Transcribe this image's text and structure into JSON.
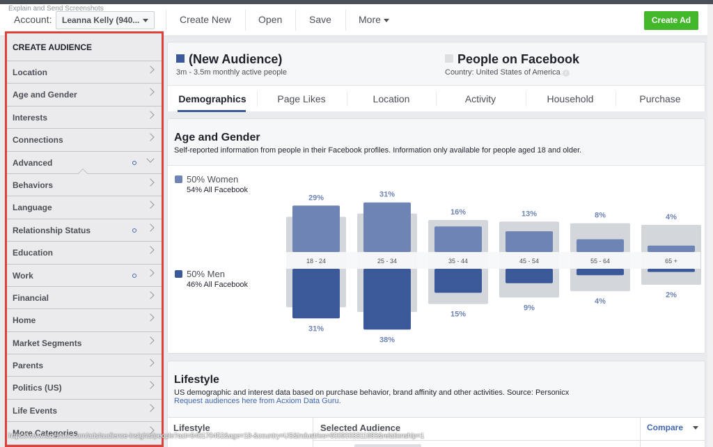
{
  "overlay_caption": "Explain and Send Screenshots",
  "header": {
    "account_label": "Account:",
    "account_value": "Leanna Kelly (940...",
    "nav": [
      "Create New",
      "Open",
      "Save",
      "More"
    ],
    "create_ad": "Create Ad",
    "create_ad_color": "#42b72a"
  },
  "sidebar": {
    "title": "CREATE AUDIENCE",
    "items": [
      {
        "label": "Location",
        "dot": false,
        "expanded": false
      },
      {
        "label": "Age and Gender",
        "dot": false,
        "expanded": false
      },
      {
        "label": "Interests",
        "dot": false,
        "expanded": false
      },
      {
        "label": "Connections",
        "dot": false,
        "expanded": false
      },
      {
        "label": "Advanced",
        "dot": true,
        "expanded": true
      },
      {
        "label": "Behaviors",
        "dot": false,
        "expanded": false
      },
      {
        "label": "Language",
        "dot": false,
        "expanded": false
      },
      {
        "label": "Relationship Status",
        "dot": true,
        "expanded": false
      },
      {
        "label": "Education",
        "dot": false,
        "expanded": false
      },
      {
        "label": "Work",
        "dot": true,
        "expanded": false
      },
      {
        "label": "Financial",
        "dot": false,
        "expanded": false
      },
      {
        "label": "Home",
        "dot": false,
        "expanded": false
      },
      {
        "label": "Market Segments",
        "dot": false,
        "expanded": false
      },
      {
        "label": "Parents",
        "dot": false,
        "expanded": false
      },
      {
        "label": "Politics (US)",
        "dot": false,
        "expanded": false
      },
      {
        "label": "Life Events",
        "dot": false,
        "expanded": false
      },
      {
        "label": "More Categories",
        "dot": false,
        "expanded": false
      }
    ]
  },
  "audience": {
    "selected_title": "(New Audience)",
    "selected_sub": "3m - 3.5m monthly active people",
    "selected_color": "#3b5998",
    "compare_title": "People on Facebook",
    "compare_sub": "Country: United States of America",
    "compare_color": "#dddfe2",
    "info_icon": "i"
  },
  "tabs": [
    "Demographics",
    "Page Likes",
    "Location",
    "Activity",
    "Household",
    "Purchase"
  ],
  "active_tab": "Demographics",
  "age_gender": {
    "title": "Age and Gender",
    "subtitle": "Self-reported information from people in their Facebook profiles. Information only available for people aged 18 and older.",
    "women_label": "50% Women",
    "women_sub": "54% All Facebook",
    "men_label": "50% Men",
    "men_sub": "46% All Facebook"
  },
  "chart_data": {
    "type": "bar",
    "title": "Age and Gender",
    "categories": [
      "18 - 24",
      "25 - 34",
      "35 - 44",
      "45 - 54",
      "55 - 64",
      "65 +"
    ],
    "series": [
      {
        "name": "Women",
        "values": [
          29,
          31,
          16,
          13,
          8,
          4
        ],
        "labels": [
          "29%",
          "31%",
          "16%",
          "13%",
          "8%",
          "4%"
        ],
        "color": "#6d84b4"
      },
      {
        "name": "Men",
        "values": [
          31,
          38,
          15,
          9,
          4,
          2
        ],
        "labels": [
          "31%",
          "38%",
          "15%",
          "9%",
          "4%",
          "2%"
        ],
        "color": "#3b5998"
      },
      {
        "name": "All Facebook Women (benchmark)",
        "values": [
          22,
          24,
          20,
          19,
          18,
          17
        ],
        "color": "#d3d6db"
      },
      {
        "name": "All Facebook Men (benchmark)",
        "values": [
          24,
          27,
          22,
          18,
          14,
          10
        ],
        "color": "#d3d6db"
      }
    ],
    "orientation": "mirrored vertical (women up, men down)",
    "legend": "left"
  },
  "lifestyle": {
    "title": "Lifestyle",
    "subtitle": "US demographic and interest data based on purchase behavior, brand affinity and other activities. Source: Personicx",
    "link": "Request audiences here from Acxiom Data Guru.",
    "columns": [
      "Lifestyle",
      "Selected Audience"
    ],
    "compare": "Compare"
  },
  "status_url": "https://www.facebook.com/ads/audience-insights/people?act=940170452&age=18-&country=US&industries=6009003311983&relationship=1"
}
